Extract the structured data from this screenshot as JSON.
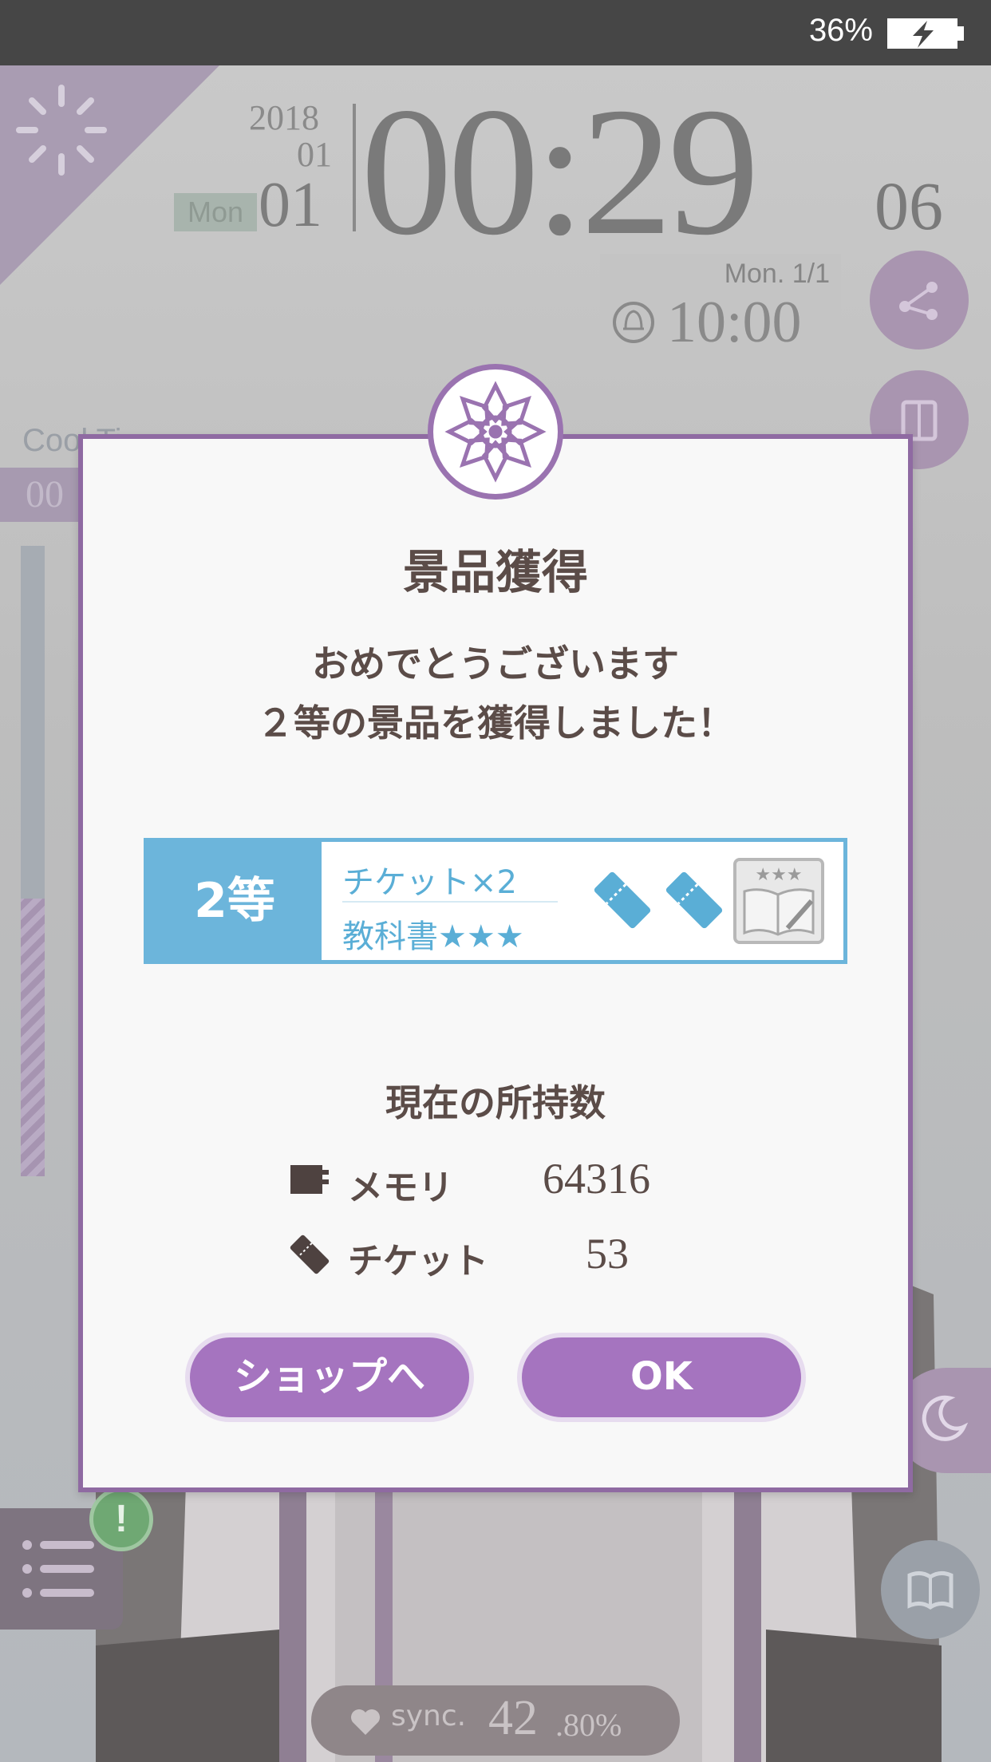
{
  "status_bar": {
    "battery_percent": "36%",
    "charging": true
  },
  "clock": {
    "year": "2018",
    "month": "01",
    "weekday": "Mon",
    "day": "01",
    "time": "00:29",
    "seconds": "06",
    "alarm_date": "Mon.  1/1",
    "alarm_time": "10:00"
  },
  "side": {
    "cooldown_label": "Cool Ti",
    "cooldown_value": "00",
    "gauge_level": 0.44
  },
  "sync": {
    "label": "sync.",
    "value_int": "42",
    "value_dec": ".80%"
  },
  "alert_badge": "!",
  "dialog": {
    "title": "景品獲得",
    "message_line1": "おめでとうございます",
    "message_line2": "２等の景品を獲得しました！",
    "prize": {
      "rank": "2等",
      "item1": "チケット×2",
      "item2": "教科書★★★"
    },
    "holdings_title": "現在の所持数",
    "holdings": [
      {
        "icon": "memory-card-icon",
        "label": "メモリ",
        "value": "64316"
      },
      {
        "icon": "ticket-icon",
        "label": "チケット",
        "value": "53"
      }
    ],
    "buttons": {
      "shop": "ショップへ",
      "ok": "OK"
    }
  },
  "colors": {
    "accent_purple": "#a574bf",
    "dialog_border": "#8f6aa2",
    "prize_blue": "#6cb5db",
    "text_brown": "#5b4c48"
  }
}
